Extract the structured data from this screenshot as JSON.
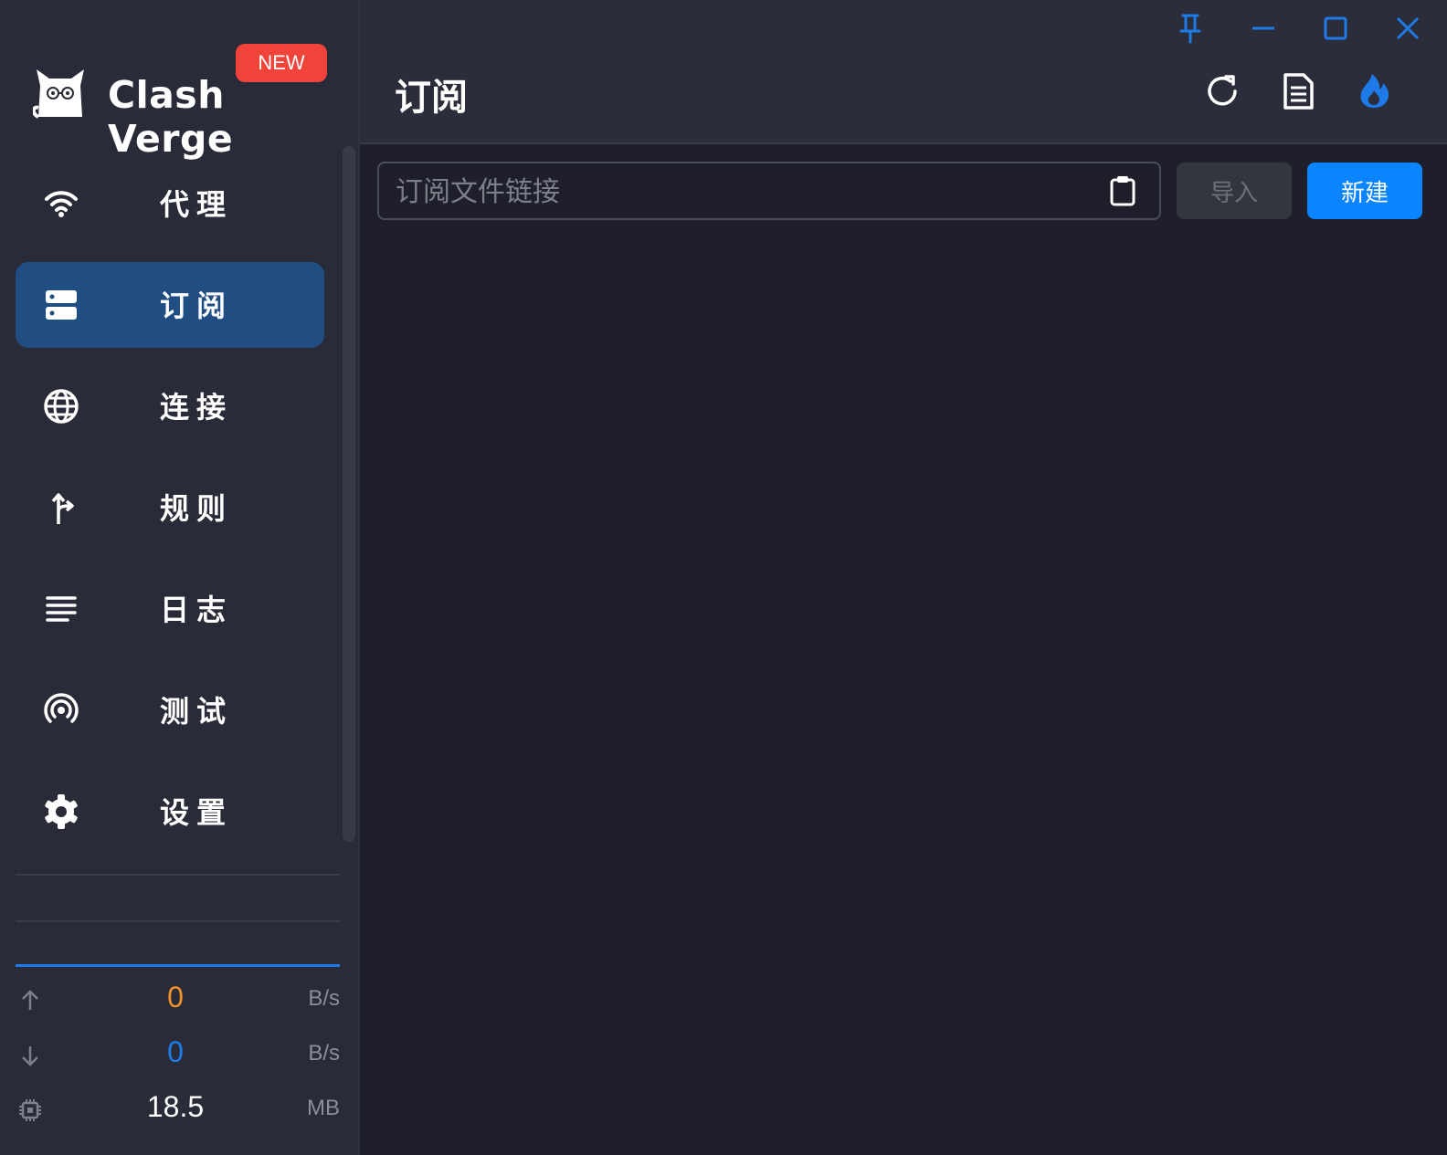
{
  "app": {
    "name": "Clash Verge",
    "badge": "NEW"
  },
  "window_controls": {
    "pin_icon": "pin-icon",
    "minimize_icon": "minimize-icon",
    "maximize_icon": "maximize-icon",
    "close_icon": "close-icon",
    "color": "#1e7ae6"
  },
  "sidebar": {
    "items": [
      {
        "label": "代理",
        "icon": "wifi-icon",
        "active": false
      },
      {
        "label": "订阅",
        "icon": "server-icon",
        "active": true
      },
      {
        "label": "连接",
        "icon": "globe-icon",
        "active": false
      },
      {
        "label": "规则",
        "icon": "fork-arrow-icon",
        "active": false
      },
      {
        "label": "日志",
        "icon": "lines-icon",
        "active": false
      },
      {
        "label": "测试",
        "icon": "signal-icon",
        "active": false
      },
      {
        "label": "设置",
        "icon": "gear-icon",
        "active": false
      }
    ],
    "active_color": "#204e82"
  },
  "traffic": {
    "upload": {
      "value": "0",
      "unit": "B/s",
      "color": "#f0922b"
    },
    "download": {
      "value": "0",
      "unit": "B/s",
      "color": "#1e7ae6"
    },
    "memory": {
      "value": "18.5",
      "unit": "MB",
      "color": "#ffffff"
    }
  },
  "header": {
    "title": "订阅",
    "actions": [
      "refresh-icon",
      "document-icon",
      "flame-icon"
    ]
  },
  "subscription": {
    "url_placeholder": "订阅文件链接",
    "url_value": "",
    "import_label": "导入",
    "new_label": "新建",
    "accent": "#0a84ff"
  }
}
